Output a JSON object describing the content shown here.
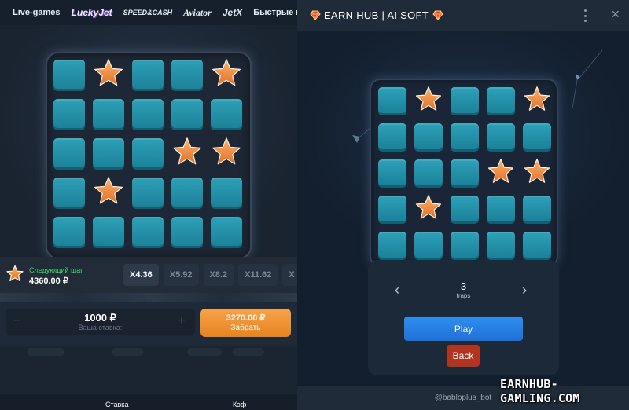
{
  "left_app": {
    "nav": {
      "items": [
        "Live-games",
        "LuckyJet",
        "SPEED&CASH",
        "Aviator",
        "JetX",
        "Быстрые игры"
      ]
    },
    "board": {
      "rows": [
        [
          "tile",
          "star",
          "tile",
          "tile",
          "star"
        ],
        [
          "tile",
          "tile",
          "tile",
          "tile",
          "tile"
        ],
        [
          "tile",
          "tile",
          "tile",
          "star",
          "star"
        ],
        [
          "tile",
          "star",
          "tile",
          "tile",
          "tile"
        ],
        [
          "tile",
          "tile",
          "tile",
          "tile",
          "tile"
        ]
      ]
    },
    "next_step": {
      "label": "Следующий шаг",
      "value": "4360.00 ₽",
      "icon": "star-icon"
    },
    "multipliers": [
      "X4.36",
      "X5.92",
      "X8.2",
      "X11.62",
      "X"
    ],
    "active_multiplier_index": 0,
    "bet": {
      "amount": "1000 ₽",
      "label": "Ваша ставка:",
      "minus": "−",
      "plus": "+"
    },
    "collect": {
      "amount": "3270.00 ₽",
      "label": "Забрать"
    },
    "bottom_tabs": [
      "Ставка",
      "Кэф"
    ]
  },
  "right_app": {
    "header": {
      "title": "EARN HUB | AI SOFT",
      "icon": "heart-gem-icon"
    },
    "board": {
      "rows": [
        [
          "tile",
          "star",
          "tile",
          "tile",
          "star"
        ],
        [
          "tile",
          "tile",
          "tile",
          "tile",
          "tile"
        ],
        [
          "tile",
          "tile",
          "tile",
          "star",
          "star"
        ],
        [
          "tile",
          "star",
          "tile",
          "tile",
          "tile"
        ],
        [
          "tile",
          "tile",
          "tile",
          "tile",
          "tile"
        ]
      ]
    },
    "traps": {
      "count": "3",
      "label": "traps",
      "prev": "‹",
      "next": "›"
    },
    "play_label": "Play",
    "back_label": "Back",
    "footer_text": "@babloplus_bot"
  },
  "watermark": "EARNHUB-GAMLING.COM",
  "colors": {
    "tile": "#2397ae",
    "star": "#f08a3a",
    "play": "#2a84e8",
    "back": "#b2341f",
    "collect": "#f2932f",
    "next_step_label": "#3ed46b"
  }
}
